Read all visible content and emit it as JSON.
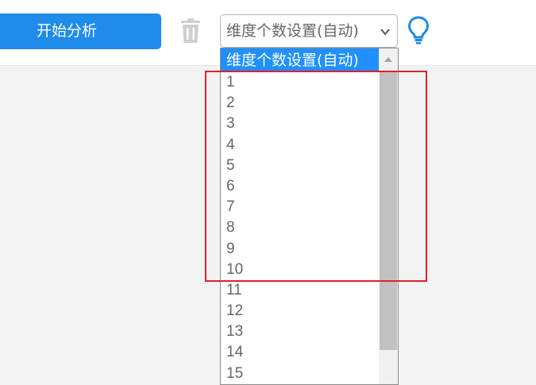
{
  "toolbar": {
    "start_button_label": "开始分析",
    "delete_icon": "trash-icon",
    "hint_icon": "lightbulb-icon",
    "dimension_select": {
      "value": "维度个数设置(自动)",
      "chevron_icon": "chevron-down-icon"
    }
  },
  "dropdown": {
    "options": [
      "维度个数设置(自动)",
      "1",
      "2",
      "3",
      "4",
      "5",
      "6",
      "7",
      "8",
      "9",
      "10",
      "11",
      "12",
      "13",
      "14",
      "15"
    ],
    "selected_index": 0
  },
  "colors": {
    "accent": "#1f8ceb",
    "option_selected_bg": "#1e90ff",
    "highlight_border": "#e0202e",
    "bulb": "#1e88e5",
    "trash": "#cfcfcf"
  }
}
